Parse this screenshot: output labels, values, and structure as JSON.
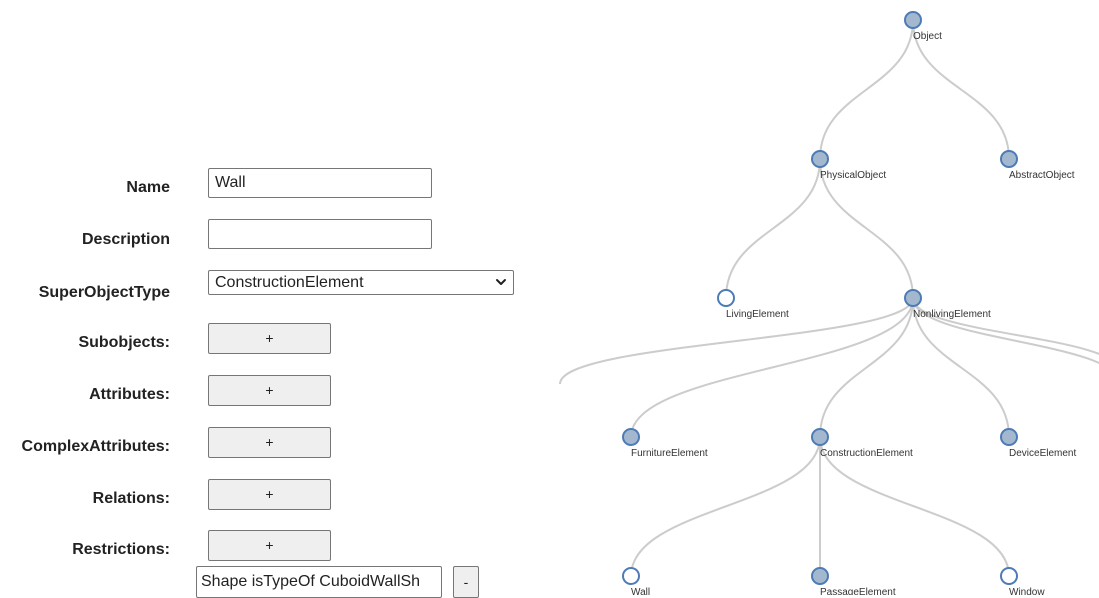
{
  "form": {
    "labels": {
      "name": "Name",
      "description": "Description",
      "super_object_type": "SuperObjectType",
      "subobjects": "Subobjects:",
      "attributes": "Attributes:",
      "complex_attributes": "ComplexAttributes:",
      "relations": "Relations:",
      "restrictions": "Restrictions:"
    },
    "name_value": "Wall",
    "description_value": "",
    "super_object_type_value": "ConstructionElement",
    "add_button_label": "+",
    "restriction_value": "Shape isTypeOf CuboidWallSh",
    "remove_button_label": "-"
  },
  "tree": {
    "colors": {
      "collapsed_fill": "#a3b8cf",
      "leaf_fill": "#ffffff",
      "node_stroke": "#4d7bb5",
      "link_stroke": "#cccccc"
    },
    "nodes": [
      {
        "id": "object",
        "label": "Object",
        "collapsed": true
      },
      {
        "id": "physical",
        "label": "PhysicalObject",
        "collapsed": true
      },
      {
        "id": "abstract",
        "label": "AbstractObject",
        "collapsed": true
      },
      {
        "id": "living",
        "label": "LivingElement",
        "collapsed": false
      },
      {
        "id": "nonliving",
        "label": "NonlivingElement",
        "collapsed": true
      },
      {
        "id": "furniture",
        "label": "FurnitureElement",
        "collapsed": true
      },
      {
        "id": "construction",
        "label": "ConstructionElement",
        "collapsed": true
      },
      {
        "id": "device",
        "label": "DeviceElement",
        "collapsed": true
      },
      {
        "id": "wall",
        "label": "Wall",
        "collapsed": false
      },
      {
        "id": "passage",
        "label": "PassageElement",
        "collapsed": true
      },
      {
        "id": "window",
        "label": "Window",
        "collapsed": false
      }
    ],
    "links": [
      [
        "object",
        "physical"
      ],
      [
        "object",
        "abstract"
      ],
      [
        "physical",
        "living"
      ],
      [
        "physical",
        "nonliving"
      ],
      [
        "nonliving",
        "furniture"
      ],
      [
        "nonliving",
        "construction"
      ],
      [
        "nonliving",
        "device"
      ],
      [
        "construction",
        "wall"
      ],
      [
        "construction",
        "passage"
      ],
      [
        "construction",
        "window"
      ]
    ]
  }
}
